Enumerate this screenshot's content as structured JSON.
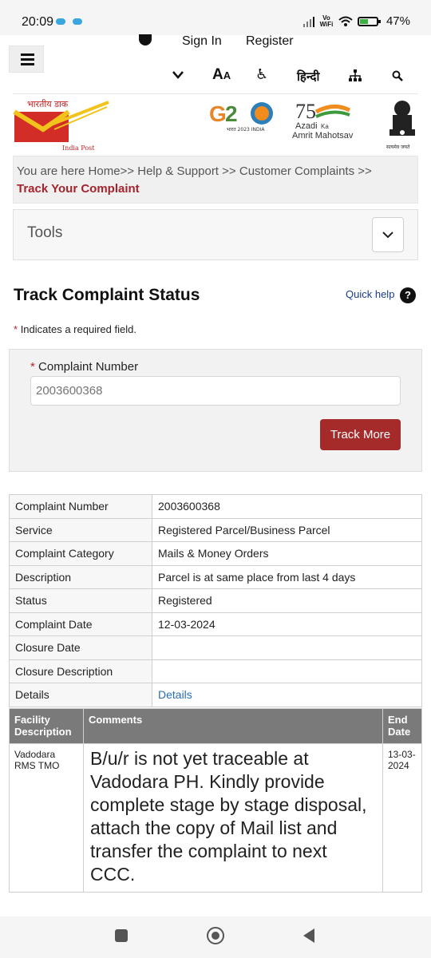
{
  "status_bar": {
    "time": "20:09",
    "network": "Vo WiFi",
    "battery": "47%",
    "battery_level": 0.47
  },
  "header": {
    "sign_in": "Sign In",
    "register": "Register",
    "hindi": "हिन्दी",
    "tool_icons": [
      "chevron-down-icon",
      "text-size-icon",
      "accessibility-icon",
      "language-icon",
      "sitemap-icon",
      "search-icon"
    ]
  },
  "logos": {
    "india_post_hindi": "भारतीय डाक",
    "india_post_english": "India Post",
    "g20": "G20",
    "azadi_line1": "Azadi",
    "azadi_ka": "Ka",
    "azadi_line2": "Amrit Mahotsav",
    "emblem_text": "सत्यमेव जयते"
  },
  "breadcrumb": {
    "prefix": "You are here",
    "items": [
      "Home",
      "Help & Support",
      "Customer Complaints"
    ],
    "separator": ">>",
    "current": "Track Your Complaint"
  },
  "tools": {
    "label": "Tools"
  },
  "page": {
    "title": "Track Complaint Status",
    "quick_help": "Quick help",
    "required_note": "Indicates a required field."
  },
  "form": {
    "label": "Complaint Number",
    "placeholder": "2003600368",
    "button": "Track More"
  },
  "details": [
    {
      "key": "Complaint Number",
      "value": "2003600368"
    },
    {
      "key": "Service",
      "value": "Registered Parcel/Business Parcel"
    },
    {
      "key": "Complaint Category",
      "value": "Mails & Money Orders"
    },
    {
      "key": "Description",
      "value": "Parcel is at same place from last 4 days"
    },
    {
      "key": "Status",
      "value": "Registered"
    },
    {
      "key": "Complaint Date",
      "value": "12-03-2024"
    },
    {
      "key": "Closure Date",
      "value": ""
    },
    {
      "key": "Closure Description",
      "value": ""
    },
    {
      "key": "Details",
      "value": "Details"
    }
  ],
  "comments_table": {
    "headers": [
      "Facility Description",
      "Comments",
      "End Date"
    ],
    "row": {
      "facility": "Vadodara RMS TMO",
      "comment": "B/u/r is not yet traceable at Vadodara PH. Kindly provide complete stage by stage disposal, attach the copy of Mail list and transfer the complaint to next CCC.",
      "end_date": "13-03-2024"
    }
  },
  "colors": {
    "accent": "#a52a2a",
    "link": "#2a6db5",
    "header_gray": "#7a7a7a"
  }
}
